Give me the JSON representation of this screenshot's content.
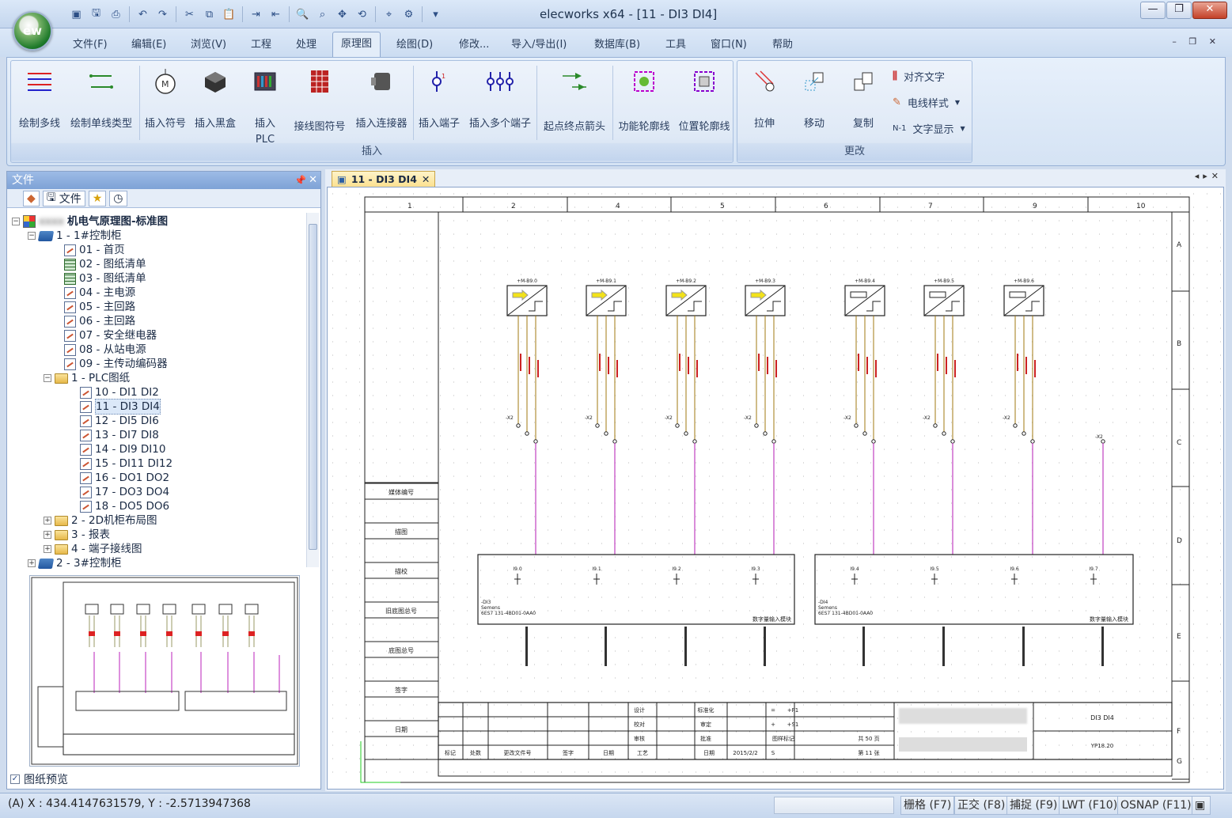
{
  "window": {
    "title": "elecworks x64 - [11 - DI3 DI4]",
    "app_orb": "ew"
  },
  "quick_access": [
    "new-icon",
    "save-icon",
    "print-icon",
    "undo-icon",
    "redo-icon",
    "cut-icon",
    "copy-icon",
    "paste-icon",
    "import-icon",
    "export-icon",
    "zoom-window-icon",
    "zoom-icon",
    "pan-icon",
    "redraw-icon",
    "find-icon",
    "settings-icon",
    "dropdown-icon"
  ],
  "menu": {
    "tabs": [
      "文件(F)",
      "编辑(E)",
      "浏览(V)",
      "工程",
      "处理",
      "原理图",
      "绘图(D)",
      "修改...",
      "导入/导出(I)",
      "数据库(B)",
      "工具",
      "窗口(N)",
      "帮助"
    ],
    "active": "原理图"
  },
  "ribbon": {
    "insert_group": {
      "label": "插入",
      "buttons": [
        "绘制多线",
        "绘制单线类型",
        "插入符号",
        "插入黑盒",
        "插入",
        "PLC",
        "接线图符号",
        "插入连接器",
        "插入端子",
        "插入多个端子",
        "起点终点箭头",
        "功能轮廓线",
        "位置轮廓线"
      ]
    },
    "modify_group": {
      "label": "更改",
      "buttons": [
        "拉伸",
        "移动",
        "复制"
      ],
      "small": [
        "对齐文字",
        "电线样式",
        "文字显示"
      ]
    }
  },
  "panel": {
    "title": "文件",
    "tab_label": "文件",
    "tree": [
      {
        "label": "机电气原理图-标准图",
        "blurred": "xxxx"
      },
      {
        "label": "1 - 1#控制柜"
      },
      {
        "label": "01 - 首页"
      },
      {
        "label": "02 - 图纸清单"
      },
      {
        "label": "03 - 图纸清单"
      },
      {
        "label": "04 - 主电源"
      },
      {
        "label": "05 - 主回路"
      },
      {
        "label": "06 - 主回路"
      },
      {
        "label": "07 - 安全继电器"
      },
      {
        "label": "08 - 从站电源"
      },
      {
        "label": "09 - 主传动编码器"
      },
      {
        "label": "1 - PLC图纸"
      },
      {
        "label": "10 - DI1 DI2"
      },
      {
        "label": "11 - DI3 DI4"
      },
      {
        "label": "12 - DI5 DI6"
      },
      {
        "label": "13 - DI7 DI8"
      },
      {
        "label": "14 - DI9 DI10"
      },
      {
        "label": "15 - DI11 DI12"
      },
      {
        "label": "16 - DO1 DO2"
      },
      {
        "label": "17 - DO3 DO4"
      },
      {
        "label": "18 - DO5 DO6"
      },
      {
        "label": "2 - 2D机柜布局图"
      },
      {
        "label": "3 - 报表"
      },
      {
        "label": "4 - 端子接线图"
      },
      {
        "label": "2 - 3#控制柜"
      }
    ],
    "preview_label": "图纸预览"
  },
  "document": {
    "tab": "11 - DI3 DI4",
    "columns": [
      "1",
      "2",
      "4",
      "5",
      "6",
      "7",
      "9",
      "10"
    ],
    "rows": [
      "A",
      "B",
      "C",
      "D",
      "E",
      "F",
      "G"
    ],
    "devices": [
      "+M-B9.0",
      "+M-B9.1",
      "+M-B9.2",
      "+M-B9.3",
      "+M-B9.4",
      "+M-B9.5",
      "+M-B9.6"
    ],
    "inputs": [
      "I9.0",
      "I9.1",
      "I9.2",
      "I9.3",
      "I9.4",
      "I9.5",
      "I9.6",
      "I9.7"
    ],
    "terminal_tag": "-X2",
    "module_left": {
      "tag": "-DI3",
      "maker": "Semens",
      "part": "6ES7 131-4BD01-0AA0",
      "title": "数字量输入模块"
    },
    "module_right": {
      "tag": "-DI4",
      "maker": "Semens",
      "part": "6ES7 131-4BD01-0AA0",
      "title": "数字量输入模块"
    },
    "left_labels": [
      "媒体编号",
      "描图",
      "描校",
      "旧底图总号",
      "底图总号",
      "签字",
      "日期"
    ],
    "title_block": {
      "row1": [
        "设计",
        "标准化",
        "=",
        "+F1"
      ],
      "row2": [
        "校对",
        "审定",
        "+",
        "+S1"
      ],
      "row3": [
        "审核",
        "批准",
        "图样标记",
        "共 50 页"
      ],
      "row4": [
        "标记",
        "处数",
        "更改文件号",
        "签字",
        "日期",
        "工艺",
        "日期",
        "2015/2/2",
        "S",
        "第 11 张"
      ],
      "sheet_title": "DI3 DI4",
      "code": "YP18.20"
    }
  },
  "status": {
    "coords": "(A) X : 434.4147631579, Y : -2.5713947368",
    "buttons": [
      "栅格 (F7)",
      "正交 (F8)",
      "捕捉 (F9)",
      "LWT (F10)",
      "OSNAP (F11)"
    ]
  }
}
